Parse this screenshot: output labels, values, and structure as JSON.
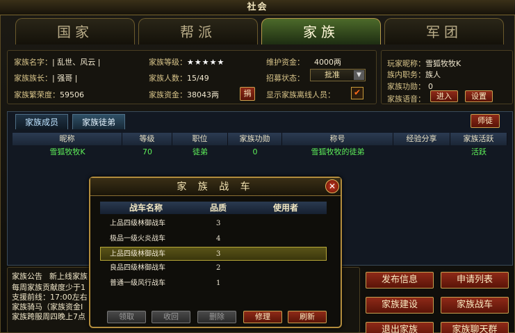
{
  "window": {
    "title": "社会"
  },
  "main_tabs": [
    {
      "label": "国家"
    },
    {
      "label": "帮派"
    },
    {
      "label": "家族"
    },
    {
      "label": "军团"
    }
  ],
  "family_info": {
    "name_label": "家族名字：",
    "name_value": "| 乱世、风云 |",
    "leader_label": "家族族长：",
    "leader_value": "| 强哥 |",
    "prosperity_label": "家族繁荣度：",
    "prosperity_value": "59506",
    "level_label": "家族等级：",
    "level_value": "★★★★★",
    "members_label": "家族人数：",
    "members_value": "15/49",
    "funds_label": "家族资金：",
    "funds_value": "38043两",
    "donate_button": "捐",
    "maintenance_label": "维护资金：",
    "maintenance_value": "4000两",
    "recruit_label": "招募状态：",
    "recruit_value": "批准",
    "show_offline_label": "显示家族离线人员：",
    "show_offline_checked": "✔"
  },
  "player_info": {
    "nickname_label": "玩家昵称：",
    "nickname_value": "雪狐牧牧K",
    "position_label": "族内职务：",
    "position_value": "族人",
    "merit_label": "家族功勋：",
    "merit_value": "0",
    "voice_label": "家族语音：",
    "enter_button": "进入",
    "settings_button": "设置"
  },
  "sub_tabs": [
    {
      "label": "家族成员"
    },
    {
      "label": "家族徒弟"
    }
  ],
  "mentor_button": "师徒",
  "member_table": {
    "headers": [
      "昵称",
      "等级",
      "职位",
      "家族功勋",
      "称号",
      "经验分享",
      "家族活跃"
    ],
    "rows": [
      {
        "nickname": "雪狐牧牧K",
        "level": "70",
        "position": "徒弟",
        "merit": "0",
        "title": "雪狐牧牧的徒弟",
        "exp_share": "",
        "activity": "活跃"
      }
    ]
  },
  "announcement": {
    "label": "家族公告",
    "lines": [
      "新上线家族",
      "每周家族贡献度少于1",
      "支援前线：17:00左右",
      "家族骑马（家族资金Ⅰ",
      "家族跨服周四晚上7点"
    ]
  },
  "side_buttons": {
    "publish": "发布信息",
    "apply_list": "申请列表",
    "build": "家族建设",
    "chariot": "家族战车",
    "quit": "退出家族",
    "chat": "家族聊天群"
  },
  "chariot_dialog": {
    "title": "家 族 战 车",
    "close_icon": "close-icon",
    "headers": [
      "战车名称",
      "品质",
      "使用者"
    ],
    "rows": [
      {
        "name": "上品四级林御战车",
        "quality": "3",
        "user": ""
      },
      {
        "name": "极品一级火炎战车",
        "quality": "4",
        "user": ""
      },
      {
        "name": "上品四级林御战车",
        "quality": "3",
        "user": ""
      },
      {
        "name": "良品四级林御战车",
        "quality": "2",
        "user": ""
      },
      {
        "name": "普通一级风行战车",
        "quality": "1",
        "user": ""
      }
    ],
    "selected_row": 2,
    "buttons": {
      "claim": "领取",
      "recycle": "收回",
      "delete": "删除",
      "repair": "修理",
      "refresh": "刷新"
    }
  },
  "colors": {
    "gold_border": "#b38d3d",
    "active_tab": "#4c6a2a",
    "member_green": "#5ef05a",
    "button_red": "#8e2a18"
  }
}
